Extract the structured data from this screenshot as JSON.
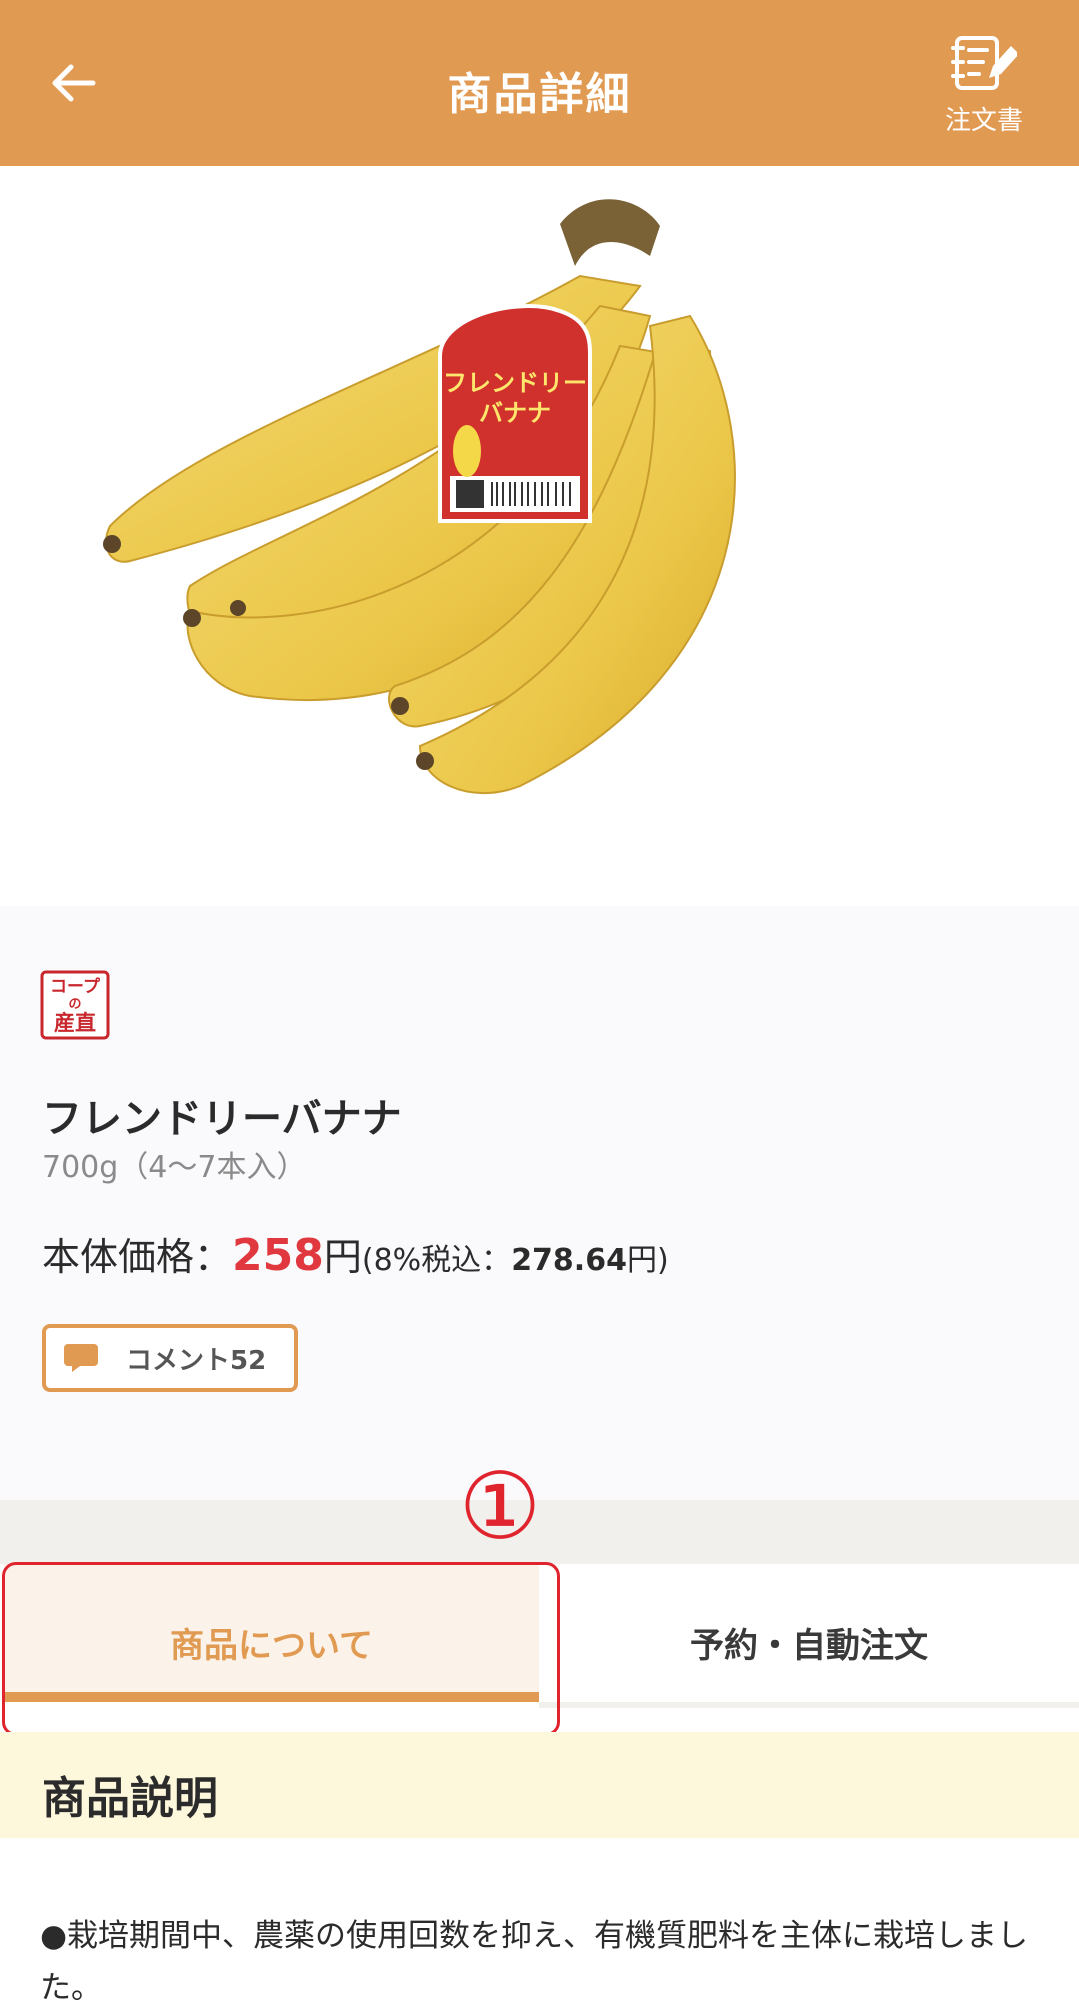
{
  "header": {
    "title": "商品詳細",
    "order_label": "注文書",
    "background_color": "#e19a52"
  },
  "product": {
    "badge_lines": [
      "コープ",
      "の",
      "産直"
    ],
    "name": "フレンドリーバナナ",
    "size": "700g（4〜7本入）",
    "price_prefix": "本体価格：",
    "price": "258",
    "price_unit": "円",
    "tax_prefix": "(8%税込：",
    "tax_price": "278.64",
    "tax_suffix": "円)",
    "label_title_1": "フレンドリー",
    "label_title_2": "バナナ"
  },
  "comment_button": {
    "label": "コメント52"
  },
  "annotation": {
    "marker": "①",
    "color": "#e0242e"
  },
  "tabs": [
    {
      "label": "商品について",
      "active": true
    },
    {
      "label": "予約・自動注文",
      "active": false
    }
  ],
  "section": {
    "title": "商品説明",
    "description": "●栽培期間中、農薬の使用回数を抑え、有機質肥料を主体に栽培しました。"
  },
  "colors": {
    "accent": "#e19a52",
    "price_red": "#e0383e",
    "section_bg": "#fdf7dc"
  }
}
